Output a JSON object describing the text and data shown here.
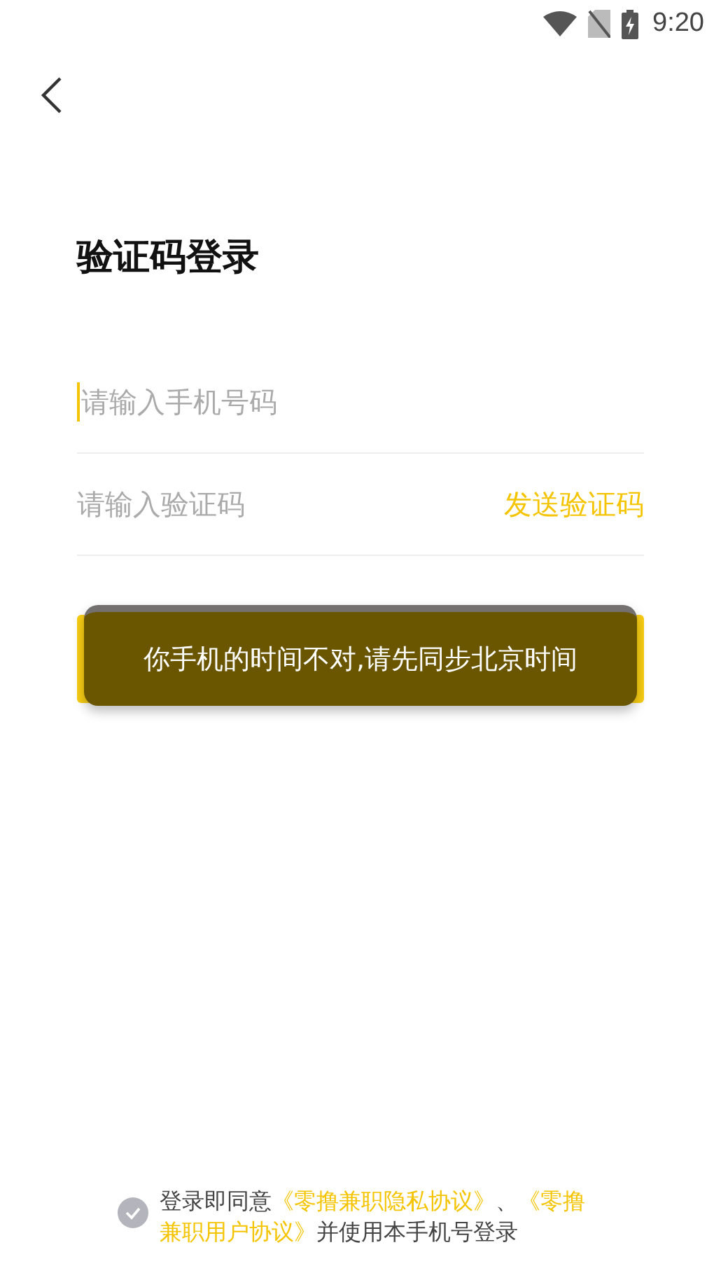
{
  "status_bar": {
    "time": "9:20"
  },
  "title": "验证码登录",
  "fields": [
    {
      "kind": "phone",
      "placeholder": "请输入手机号码",
      "focused": true
    },
    {
      "kind": "code",
      "placeholder": "请输入验证码",
      "focused": false,
      "action": "发送验证码"
    }
  ],
  "toast": "你手机的时间不对,请先同步北京时间",
  "agreement": {
    "checked": false,
    "text": "登录即同意",
    "links": [
      "《零撸兼职隐私协议》",
      "《零撸兼职用户协议》"
    ],
    "separator": "、",
    "suffix": "并使用本手机号登录"
  }
}
